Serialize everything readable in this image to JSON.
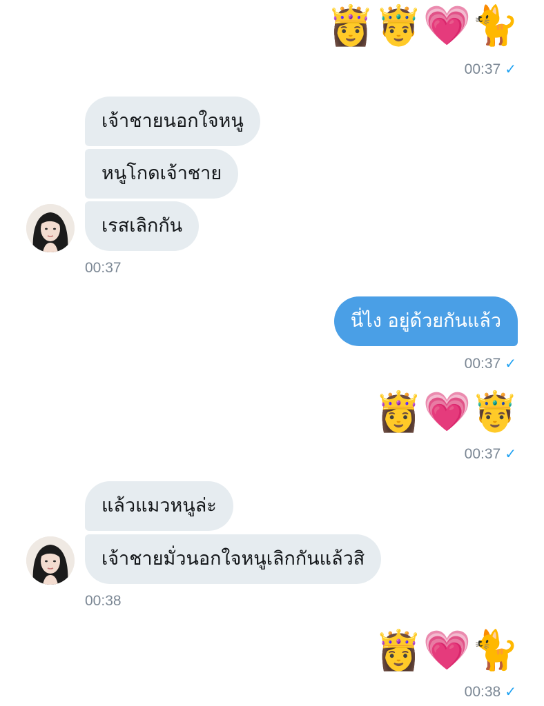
{
  "conversation": {
    "msg1": {
      "emojis": "👸🤴💗🐈",
      "time": "00:37",
      "status": "✓"
    },
    "group1": {
      "messages": [
        "เจ้าชายนอกใจหนู",
        "หนูโกดเจ้าชาย",
        "เรสเลิกกัน"
      ],
      "time": "00:37",
      "avatar": "avatar-icon"
    },
    "msg2": {
      "text": "นี่ไง อยู่ด้วยกันแล้ว",
      "time": "00:37",
      "status": "✓"
    },
    "msg3": {
      "emojis": "👸💗🤴",
      "time": "00:37",
      "status": "✓"
    },
    "group2": {
      "messages": [
        "แล้วแมวหนูล่ะ",
        "เจ้าชายมั่วนอกใจหนูเลิกกันแล้วสิ"
      ],
      "time": "00:38",
      "avatar": "avatar-icon"
    },
    "msg4": {
      "emojis": "👸💗🐈",
      "time": "00:38",
      "status": "✓"
    }
  },
  "colors": {
    "incoming_bubble": "#e6ecf0",
    "outgoing_bubble": "#4a9fe6",
    "timestamp": "#7b8794",
    "read_tick": "#1da1f2"
  }
}
